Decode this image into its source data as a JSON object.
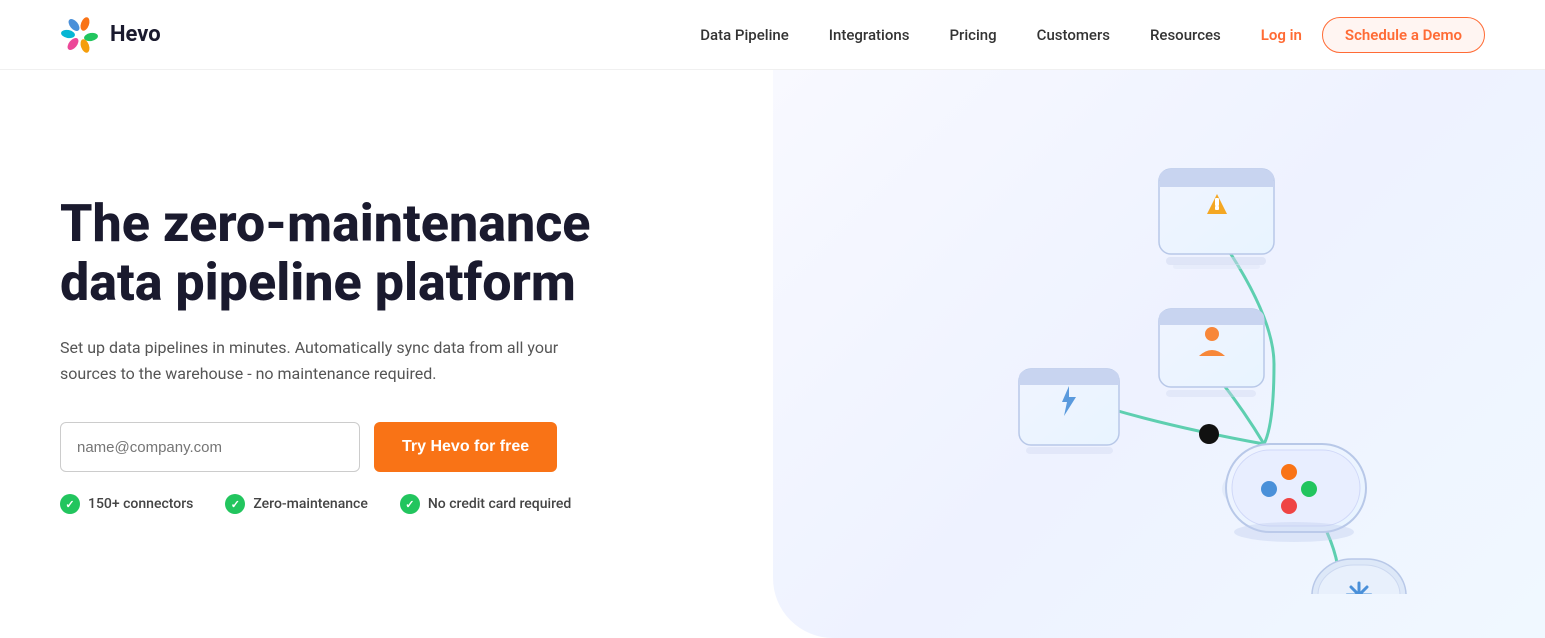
{
  "nav": {
    "logo_text": "Hevo",
    "links": [
      {
        "label": "Data Pipeline",
        "name": "nav-data-pipeline"
      },
      {
        "label": "Integrations",
        "name": "nav-integrations"
      },
      {
        "label": "Pricing",
        "name": "nav-pricing"
      },
      {
        "label": "Customers",
        "name": "nav-customers"
      },
      {
        "label": "Resources",
        "name": "nav-resources"
      }
    ],
    "login_label": "Log in",
    "demo_label": "Schedule a Demo"
  },
  "hero": {
    "title_line1": "The zero-maintenance",
    "title_line2": "data pipeline platform",
    "subtitle": "Set up data pipelines in minutes. Automatically sync data from all your sources to the warehouse - no maintenance required.",
    "email_placeholder": "name@company.com",
    "cta_label": "Try Hevo for free",
    "badges": [
      {
        "label": "150+ connectors"
      },
      {
        "label": "Zero-maintenance"
      },
      {
        "label": "No credit card required"
      }
    ]
  },
  "colors": {
    "orange": "#f97316",
    "orange_light": "#ff6b35",
    "green": "#22c55e",
    "dark": "#1a1a2e",
    "logo_orange": "#FF6B35",
    "logo_blue": "#4A90D9",
    "logo_green": "#22C55E",
    "logo_yellow": "#F59E0B",
    "logo_pink": "#EC4899"
  }
}
